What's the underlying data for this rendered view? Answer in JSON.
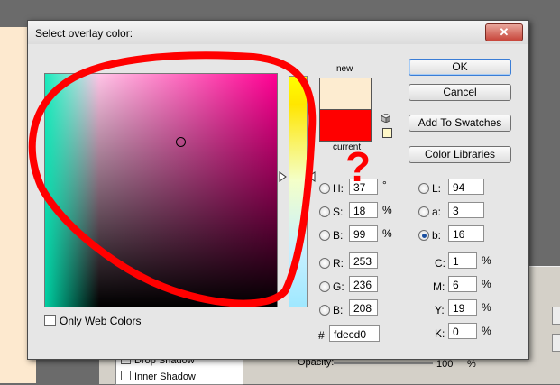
{
  "dialog": {
    "title": "Select overlay color:",
    "close_icon": "close-icon"
  },
  "swatch": {
    "new_label": "new",
    "current_label": "current",
    "new_color": "#fdecd0",
    "current_color": "#ff0000"
  },
  "buttons": {
    "ok": "OK",
    "cancel": "Cancel",
    "add_to_swatches": "Add To Swatches",
    "color_libraries": "Color Libraries"
  },
  "hsb": {
    "h_label": "H:",
    "h_value": "37",
    "h_unit": "°",
    "s_label": "S:",
    "s_value": "18",
    "s_unit": "%",
    "b_label": "B:",
    "b_value": "99",
    "b_unit": "%"
  },
  "rgb": {
    "r_label": "R:",
    "r_value": "253",
    "g_label": "G:",
    "g_value": "236",
    "b_label": "B:",
    "b_value": "208"
  },
  "lab": {
    "l_label": "L:",
    "l_value": "94",
    "a_label": "a:",
    "a_value": "3",
    "b_label": "b:",
    "b_value": "16"
  },
  "cmyk": {
    "c_label": "C:",
    "c_value": "1",
    "m_label": "M:",
    "m_value": "6",
    "y_label": "Y:",
    "y_value": "19",
    "k_label": "K:",
    "k_value": "0",
    "unit": "%"
  },
  "hex": {
    "label": "#",
    "value": "fdecd0"
  },
  "web_colors": {
    "label": "Only Web Colors",
    "checked": false
  },
  "selected_radio": "lab_b",
  "annotation": {
    "mark": "?",
    "color": "#ff0000"
  },
  "background": {
    "layer_item_1": "Drop Shadow",
    "layer_item_2": "Inner Shadow",
    "opacity_label": "Opacity:",
    "opacity_value": "100",
    "opacity_unit": "%"
  }
}
